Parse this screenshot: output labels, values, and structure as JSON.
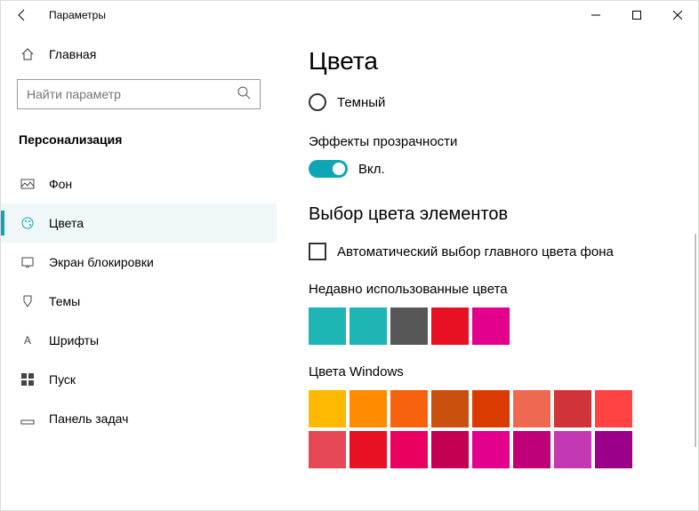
{
  "window": {
    "title": "Параметры"
  },
  "sidebar": {
    "home": "Главная",
    "search_placeholder": "Найти параметр",
    "section": "Персонализация",
    "items": [
      {
        "label": "Фон"
      },
      {
        "label": "Цвета"
      },
      {
        "label": "Экран блокировки"
      },
      {
        "label": "Темы"
      },
      {
        "label": "Шрифты"
      },
      {
        "label": "Пуск"
      },
      {
        "label": "Панель задач"
      }
    ]
  },
  "main": {
    "title": "Цвета",
    "radio_dark": "Темный",
    "transparency_label": "Эффекты прозрачности",
    "transparency_state": "Вкл.",
    "accent_section": "Выбор цвета элементов",
    "auto_pick": "Автоматический выбор главного цвета фона",
    "recent_label": "Недавно использованные цвета",
    "recent_colors": [
      "#1fb5b5",
      "#1fb5b5",
      "#575757",
      "#e81123",
      "#e3008c"
    ],
    "windows_colors_label": "Цвета Windows",
    "windows_colors": [
      [
        "#ffb900",
        "#ff8c00",
        "#f7630c",
        "#ca5010",
        "#da3b01",
        "#ef6950",
        "#d13438",
        "#ff4343"
      ],
      [
        "#e74856",
        "#e81123",
        "#ea005e",
        "#c30052",
        "#e3008c",
        "#bf0077",
        "#c239b3",
        "#9a0089"
      ]
    ]
  }
}
